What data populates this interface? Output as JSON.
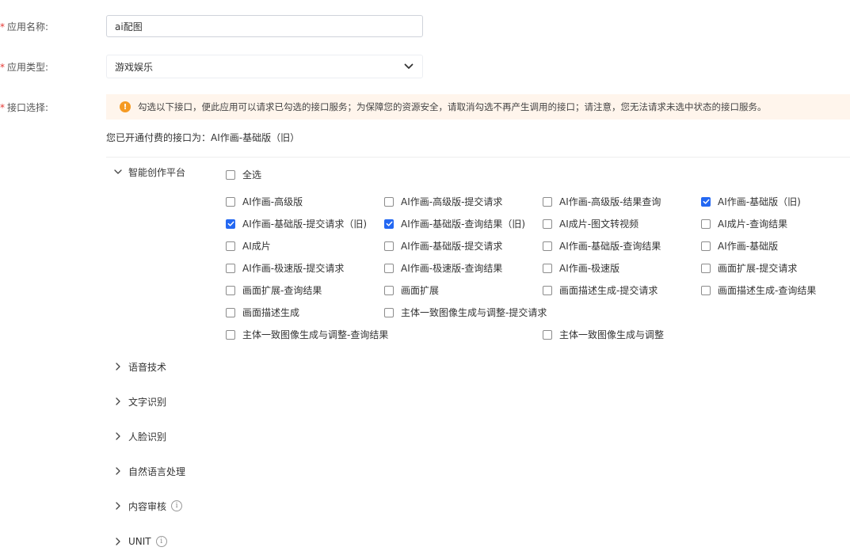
{
  "form": {
    "app_name": {
      "required": "*",
      "label": "应用名称:",
      "value": "ai配图"
    },
    "app_type": {
      "required": "*",
      "label": "应用类型:",
      "selected": "游戏娱乐"
    },
    "api_select": {
      "required": "*",
      "label": "接口选择:"
    }
  },
  "alert": {
    "icon": "warning-icon",
    "text": "勾选以下接口，便此应用可以请求已勾选的接口服务；为保障您的资源安全，请取消勾选不再产生调用的接口；请注意，您无法请求未选中状态的接口服务。",
    "color": "#f59a23"
  },
  "paid_note": "您已开通付费的接口为：AI作画-基础版（旧）",
  "accent_color": "#2468f2",
  "categories": [
    {
      "label": "智能创作平台",
      "expanded": true,
      "select_all": {
        "label": "全选",
        "checked": false
      },
      "items": [
        {
          "label": "AI作画-高级版",
          "checked": false
        },
        {
          "label": "AI作画-高级版-提交请求",
          "checked": false
        },
        {
          "label": "AI作画-高级版-结果查询",
          "checked": false
        },
        {
          "label": "AI作画-基础版（旧)",
          "checked": true
        },
        {
          "label": "AI作画-基础版-提交请求（旧)",
          "checked": true
        },
        {
          "label": "AI作画-基础版-查询结果（旧)",
          "checked": true
        },
        {
          "label": "AI成片-图文转视频",
          "checked": false
        },
        {
          "label": "AI成片-查询结果",
          "checked": false
        },
        {
          "label": "AI成片",
          "checked": false
        },
        {
          "label": "AI作画-基础版-提交请求",
          "checked": false
        },
        {
          "label": "AI作画-基础版-查询结果",
          "checked": false
        },
        {
          "label": "AI作画-基础版",
          "checked": false
        },
        {
          "label": "AI作画-极速版-提交请求",
          "checked": false
        },
        {
          "label": "AI作画-极速版-查询结果",
          "checked": false
        },
        {
          "label": "AI作画-极速版",
          "checked": false
        },
        {
          "label": "画面扩展-提交请求",
          "checked": false
        },
        {
          "label": "画面扩展-查询结果",
          "checked": false
        },
        {
          "label": "画面扩展",
          "checked": false
        },
        {
          "label": "画面描述生成-提交请求",
          "checked": false
        },
        {
          "label": "画面描述生成-查询结果",
          "checked": false
        },
        {
          "label": "画面描述生成",
          "checked": false
        },
        {
          "label": "主体一致图像生成与调整-提交请求",
          "checked": false
        },
        {
          "label": "主体一致图像生成与调整-查询结果",
          "checked": false
        },
        {
          "label": "主体一致图像生成与调整",
          "checked": false
        }
      ]
    },
    {
      "label": "语音技术",
      "expanded": false,
      "info": false
    },
    {
      "label": "文字识别",
      "expanded": false,
      "info": false
    },
    {
      "label": "人脸识别",
      "expanded": false,
      "info": false
    },
    {
      "label": "自然语言处理",
      "expanded": false,
      "info": false
    },
    {
      "label": "内容审核",
      "expanded": false,
      "info": true,
      "info_icon": "info-icon",
      "info_glyph": "i"
    },
    {
      "label": "UNIT",
      "expanded": false,
      "info": true,
      "info_icon": "info-icon",
      "info_glyph": "i"
    }
  ]
}
